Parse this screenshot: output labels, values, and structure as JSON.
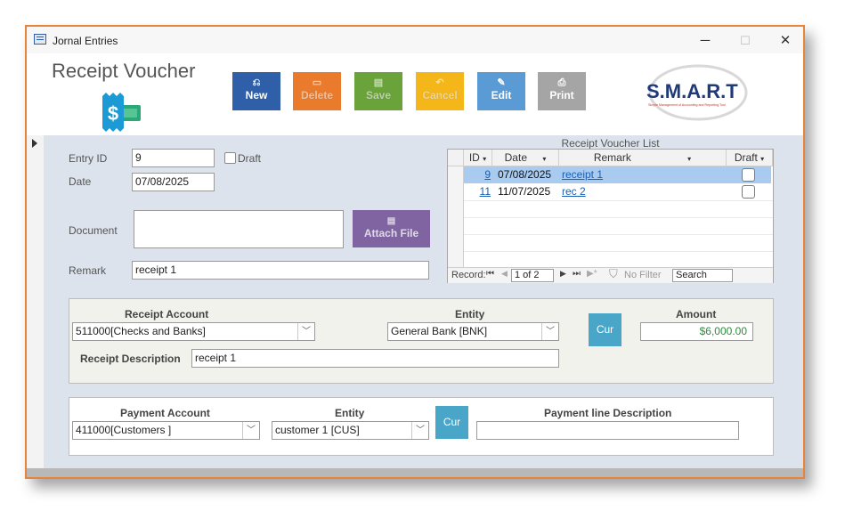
{
  "window": {
    "title": "Jornal Entries",
    "minimize_symbol": "─",
    "maximize_symbol": "☐",
    "close_symbol": "✕"
  },
  "header": {
    "page_title": "Receipt Voucher",
    "logo_text": "S.M.A.R.T",
    "logo_tagline": "Simple Management of Accounting and Reporting Tool"
  },
  "toolbar": {
    "buttons": [
      {
        "label": "New",
        "icon": "new-icon",
        "color": "#2f5fa8",
        "enabled": true
      },
      {
        "label": "Delete",
        "icon": "delete-icon",
        "color": "#ea7b2c",
        "enabled": false
      },
      {
        "label": "Save",
        "icon": "save-icon",
        "color": "#6aa339",
        "enabled": false
      },
      {
        "label": "Cancel",
        "icon": "cancel-icon",
        "color": "#f4b619",
        "enabled": false
      },
      {
        "label": "Edit",
        "icon": "edit-icon",
        "color": "#5b9bd5",
        "enabled": true
      },
      {
        "label": "Print",
        "icon": "print-icon",
        "color": "#a5a5a5",
        "enabled": true
      }
    ]
  },
  "form": {
    "entry_id_label": "Entry ID",
    "entry_id_value": "9",
    "draft_label": "Draft",
    "draft_checked": false,
    "date_label": "Date",
    "date_value": "07/08/2025",
    "document_label": "Document",
    "attach_label": "Attach File",
    "remark_label": "Remark",
    "remark_value": "receipt 1"
  },
  "voucher_list": {
    "title": "Receipt Voucher List",
    "columns": [
      "ID",
      "Date",
      "Remark",
      "Draft"
    ],
    "rows": [
      {
        "id": "9",
        "date": "07/08/2025",
        "remark": "receipt 1",
        "draft": false,
        "selected": true
      },
      {
        "id": "11",
        "date": "11/07/2025",
        "remark": "rec 2",
        "draft": false,
        "selected": false
      }
    ],
    "nav": {
      "record_label": "Record:",
      "position": "1 of 2",
      "filter_label": "No Filter",
      "search_placeholder": "Search"
    }
  },
  "receipt": {
    "account_label": "Receipt Account",
    "account_value": "511000[Checks and Banks]",
    "entity_label": "Entity",
    "entity_value": "General Bank [BNK]",
    "cur_label": "Cur",
    "amount_label": "Amount",
    "amount_value": "$6,000.00",
    "description_label": "Receipt Description",
    "description_value": "receipt 1"
  },
  "payment": {
    "account_label": "Payment Account",
    "account_value": "411000[Customers ]",
    "entity_label": "Entity",
    "entity_value": "customer 1 [CUS]",
    "cur_label": "Cur",
    "line_description_label": "Payment line Description",
    "line_description_value": ""
  },
  "colors": {
    "window_border": "#e8833a",
    "form_background": "#dde3ec",
    "cur_button": "#4aa6c8",
    "attach_button": "#8064a2",
    "amount_text": "#2e8b3e",
    "selected_row": "#a9cbf0"
  }
}
